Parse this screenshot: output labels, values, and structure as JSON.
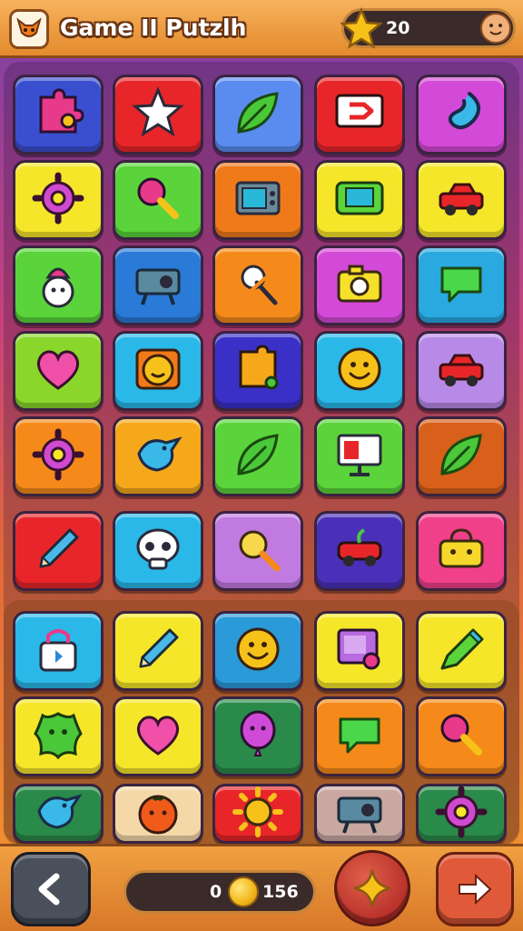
{
  "header": {
    "title": "Game II Putzlh",
    "score": "20"
  },
  "footer": {
    "coins_left": "0",
    "coins_right": "156"
  },
  "tiles": [
    {
      "icon": "puzzle-icon",
      "color": "#3a4fd0"
    },
    {
      "icon": "star-icon",
      "color": "#e8262a"
    },
    {
      "icon": "leaf-icon",
      "color": "#5a8cf0"
    },
    {
      "icon": "play-button-icon",
      "color": "#e8262a"
    },
    {
      "icon": "swirl-icon",
      "color": "#d44ad8"
    },
    {
      "icon": "gear-icon",
      "color": "#f5e62a"
    },
    {
      "icon": "rattle-icon",
      "color": "#5ad43a"
    },
    {
      "icon": "tv-icon",
      "color": "#f07a1a"
    },
    {
      "icon": "game-console-icon",
      "color": "#f5e62a"
    },
    {
      "icon": "car-icon",
      "color": "#f5e62a"
    },
    {
      "icon": "snowman-icon",
      "color": "#5ad43a"
    },
    {
      "icon": "projector-icon",
      "color": "#2a7ad8"
    },
    {
      "icon": "satellite-icon",
      "color": "#f58a1a"
    },
    {
      "icon": "camera-icon",
      "color": "#d44ad8"
    },
    {
      "icon": "chat-bubble-icon",
      "color": "#2aa8e0"
    },
    {
      "icon": "heart-icon",
      "color": "#8ad62a"
    },
    {
      "icon": "cat-face-icon",
      "color": "#2ab8e8"
    },
    {
      "icon": "puzzle-piece-icon",
      "color": "#3a30c8"
    },
    {
      "icon": "smiley-icon",
      "color": "#2ab8e8"
    },
    {
      "icon": "car-icon",
      "color": "#b88ae8"
    },
    {
      "icon": "gear-icon",
      "color": "#f58a1a"
    },
    {
      "icon": "bird-icon",
      "color": "#f5a81a"
    },
    {
      "icon": "leaf-icon",
      "color": "#5ad43a"
    },
    {
      "icon": "monitor-icon",
      "color": "#5ad43a"
    },
    {
      "icon": "leaf-icon",
      "color": "#d8601a"
    },
    {
      "icon": "pencil-icon",
      "color": "#e8262a"
    },
    {
      "icon": "skull-icon",
      "color": "#2ab8e8"
    },
    {
      "icon": "magnifier-icon",
      "color": "#c07ae0"
    },
    {
      "icon": "apple-car-icon",
      "color": "#4a30b8"
    },
    {
      "icon": "bag-icon",
      "color": "#f0408a"
    },
    {
      "icon": "lock-icon",
      "color": "#2ab8e8"
    },
    {
      "icon": "pencil-icon",
      "color": "#f5e62a"
    },
    {
      "icon": "smiley-icon",
      "color": "#2a9ad8"
    },
    {
      "icon": "photo-icon",
      "color": "#f5e62a"
    },
    {
      "icon": "marker-icon",
      "color": "#f5e62a"
    },
    {
      "icon": "blob-icon",
      "color": "#f5e62a"
    },
    {
      "icon": "heart-icon",
      "color": "#f5e62a"
    },
    {
      "icon": "balloon-icon",
      "color": "#2a8a4a"
    },
    {
      "icon": "chat-bubble-icon",
      "color": "#f58a1a"
    },
    {
      "icon": "rattle-icon",
      "color": "#f58a1a"
    },
    {
      "icon": "bird-icon",
      "color": "#2a8a4a"
    },
    {
      "icon": "tomato-icon",
      "color": "#f5d8a8"
    },
    {
      "icon": "sun-icon",
      "color": "#e8262a"
    },
    {
      "icon": "projector-icon",
      "color": "#c8a8a0"
    },
    {
      "icon": "gear-icon",
      "color": "#2a8a4a"
    }
  ]
}
